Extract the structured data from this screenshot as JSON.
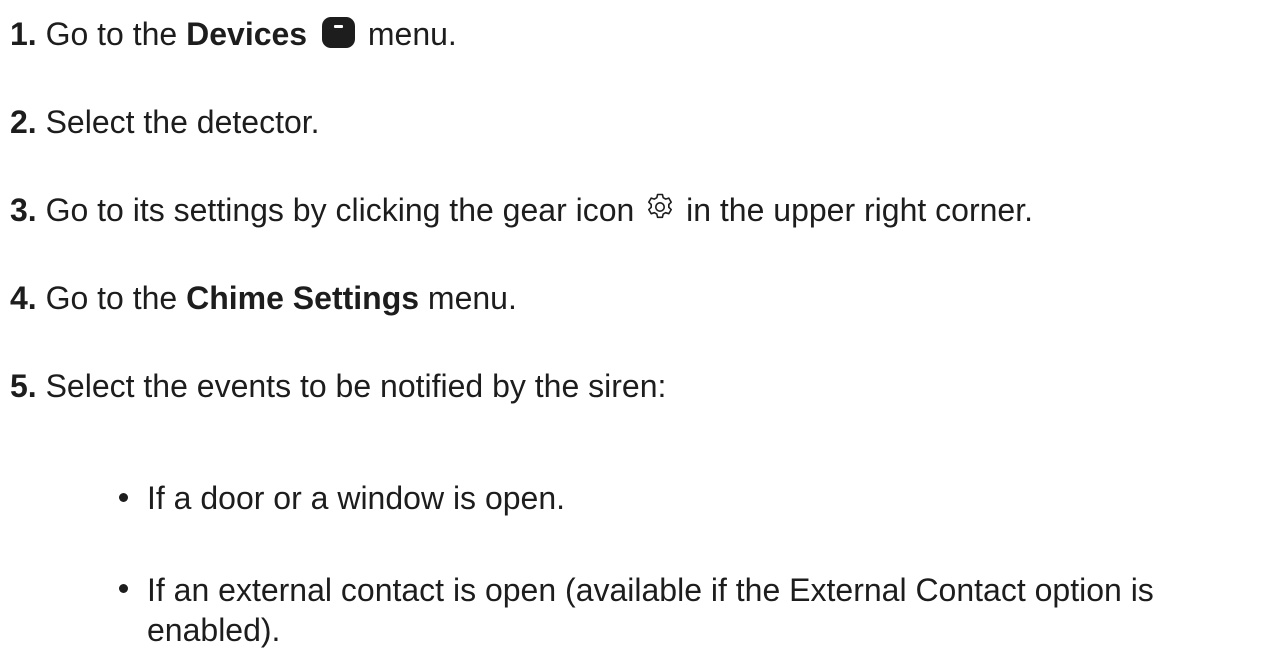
{
  "steps": [
    {
      "num": "1.",
      "pre": "Go to the ",
      "bold": "Devices",
      "icon": "devices-icon",
      "post": "menu."
    },
    {
      "num": "2.",
      "text": "Select the detector."
    },
    {
      "num": "3.",
      "pre": "Go to its settings by clicking the gear icon",
      "icon": "gear-icon",
      "post": "in the upper right corner."
    },
    {
      "num": "4.",
      "pre": "Go to the ",
      "bold": "Chime Settings",
      "post": " menu."
    },
    {
      "num": "5.",
      "text": "Select the events to be notified by the siren:"
    }
  ],
  "bullets": [
    "If a door or a window is open.",
    "If an external contact is open (available if the External Contact option is enabled)."
  ]
}
